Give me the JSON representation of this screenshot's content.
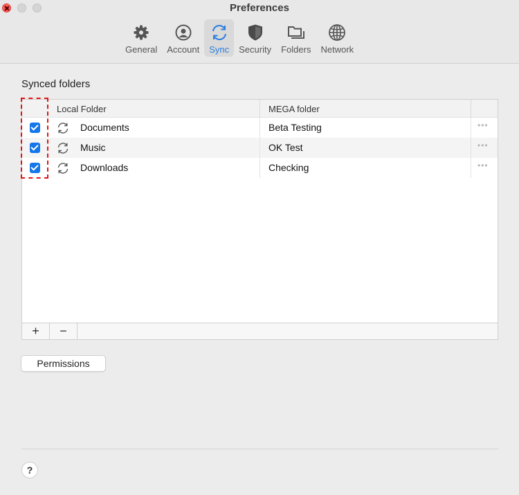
{
  "window": {
    "title": "Preferences"
  },
  "tabs": [
    {
      "label": "General",
      "icon": "gear-icon"
    },
    {
      "label": "Account",
      "icon": "account-icon"
    },
    {
      "label": "Sync",
      "icon": "sync-icon",
      "active": true
    },
    {
      "label": "Security",
      "icon": "shield-icon"
    },
    {
      "label": "Folders",
      "icon": "folders-icon"
    },
    {
      "label": "Network",
      "icon": "globe-icon"
    }
  ],
  "synced": {
    "title": "Synced folders",
    "columns": {
      "local": "Local Folder",
      "mega": "MEGA folder"
    },
    "rows": [
      {
        "checked": true,
        "local": "Documents",
        "mega": "Beta Testing",
        "menu": "•••"
      },
      {
        "checked": true,
        "local": "Music",
        "mega": "OK Test",
        "menu": "•••"
      },
      {
        "checked": true,
        "local": "Downloads",
        "mega": "Checking",
        "menu": "•••"
      }
    ],
    "add_label": "+",
    "remove_label": "−"
  },
  "buttons": {
    "permissions": "Permissions",
    "help": "?"
  },
  "colors": {
    "accent": "#2a7de1",
    "checkbox": "#1476ea",
    "highlight": "#e01414"
  }
}
